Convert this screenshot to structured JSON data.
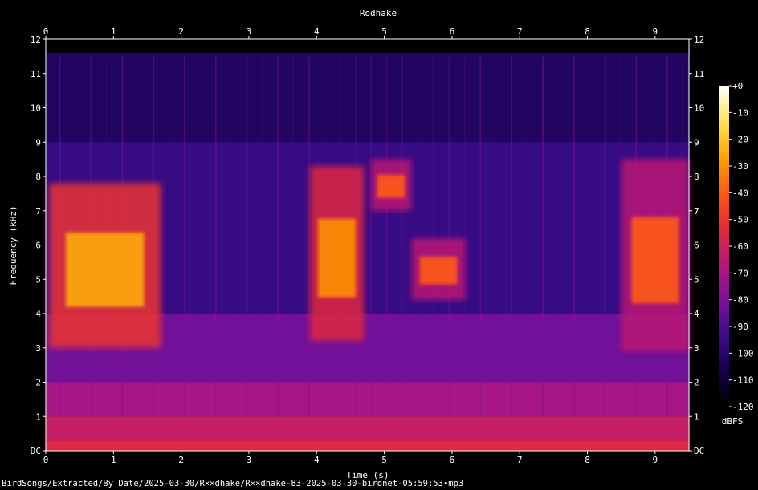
{
  "chart_data": {
    "type": "heatmap",
    "title": "Rodhake",
    "xlabel": "Time (s)",
    "ylabel": "Frequency (kHz)",
    "xlim": [
      0,
      9.5
    ],
    "ylim": [
      0,
      12
    ],
    "x_ticks": [
      "0",
      "1",
      "2",
      "3",
      "4",
      "5",
      "6",
      "7",
      "8",
      "9"
    ],
    "y_ticks": [
      "DC",
      "1",
      "2",
      "3",
      "4",
      "5",
      "6",
      "7",
      "8",
      "9",
      "10",
      "11",
      "12"
    ],
    "colorbar": {
      "label": "dBFS",
      "range": [
        -120,
        0
      ],
      "ticks": [
        "+0",
        "-10",
        "-20",
        "-30",
        "-40",
        "-50",
        "-60",
        "-70",
        "-80",
        "-90",
        "-100",
        "-110",
        "-120"
      ],
      "colors": [
        "#000000",
        "#14004a",
        "#3b0c8c",
        "#7a119a",
        "#b5177d",
        "#e52a3a",
        "#ff5a12",
        "#ffa300",
        "#ffe25a",
        "#ffffff"
      ]
    },
    "calls": [
      {
        "t_start": 0.05,
        "t_end": 1.7,
        "f_low": 3.0,
        "f_high": 7.8,
        "peak_dbfs": -25
      },
      {
        "t_start": 3.9,
        "t_end": 4.7,
        "f_low": 3.2,
        "f_high": 8.3,
        "peak_dbfs": -30
      },
      {
        "t_start": 4.8,
        "t_end": 5.4,
        "f_low": 7.0,
        "f_high": 8.5,
        "peak_dbfs": -40
      },
      {
        "t_start": 5.4,
        "t_end": 6.2,
        "f_low": 4.4,
        "f_high": 6.2,
        "peak_dbfs": -40
      },
      {
        "t_start": 8.5,
        "t_end": 9.5,
        "f_low": 2.9,
        "f_high": 8.5,
        "peak_dbfs": -40
      }
    ]
  },
  "footer": {
    "path": "BirdSongs/Extracted/By_Date/2025-03-30/R××dhake/R××dhake-83-2025-03-30-birdnet-05:59:53∙mp3"
  }
}
